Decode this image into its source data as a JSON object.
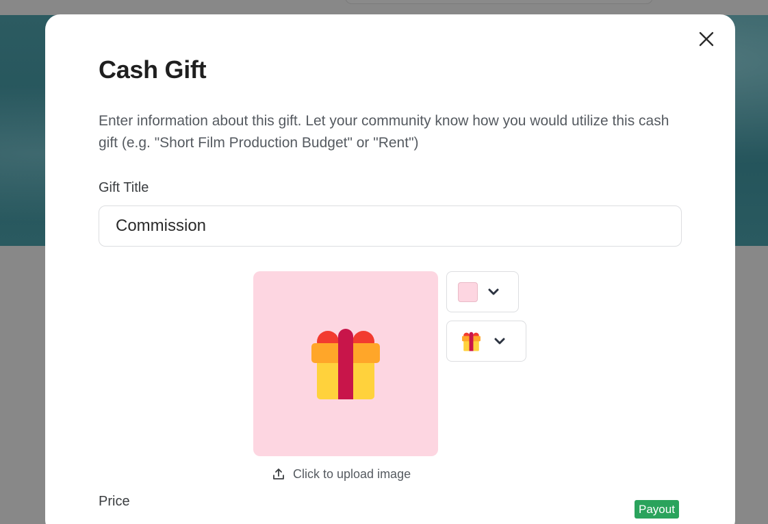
{
  "modal": {
    "title": "Cash Gift",
    "description": "Enter information about this gift. Let your community know how you would utilize this cash gift (e.g. \"Short Film Production Budget\" or \"Rent\")",
    "close_icon": "close-icon"
  },
  "gift_title": {
    "label": "Gift Title",
    "value": "Commission"
  },
  "image": {
    "background_color": "#fdd6e1",
    "icon": "gift-icon",
    "upload_label": "Click to upload image",
    "upload_icon": "upload-icon"
  },
  "pickers": {
    "color": {
      "selected": "#fdd6e1",
      "chevron_icon": "chevron-down-icon"
    },
    "icon": {
      "selected": "gift-icon",
      "chevron_icon": "chevron-down-icon"
    }
  },
  "price": {
    "label": "Price",
    "badge": "Payout",
    "badge_color": "#2aa35c"
  },
  "colors": {
    "overlay": "#888888",
    "banner": "#2c5b61",
    "text_primary": "#1f1f1f",
    "text_secondary": "#555a60"
  }
}
